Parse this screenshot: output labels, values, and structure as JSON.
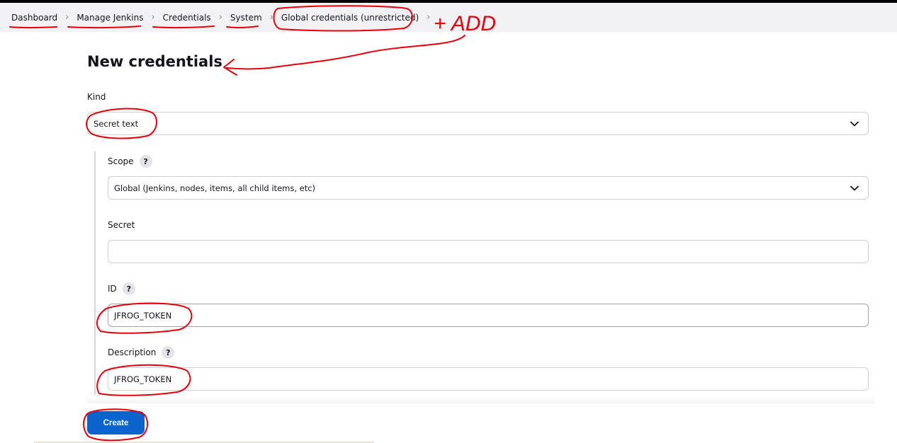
{
  "breadcrumb": {
    "items": [
      {
        "label": "Dashboard"
      },
      {
        "label": "Manage Jenkins"
      },
      {
        "label": "Credentials"
      },
      {
        "label": "System"
      },
      {
        "label": "Global credentials (unrestricted)"
      }
    ]
  },
  "page": {
    "title": "New credentials"
  },
  "form": {
    "kind": {
      "label": "Kind",
      "value": "Secret text"
    },
    "scope": {
      "label": "Scope",
      "help": "?",
      "value": "Global (Jenkins, nodes, items, all child items, etc)"
    },
    "secret": {
      "label": "Secret",
      "value": ""
    },
    "id": {
      "label": "ID",
      "help": "?",
      "value": "JFROG_TOKEN"
    },
    "description": {
      "label": "Description",
      "help": "?",
      "value": "JFROG_TOKEN"
    }
  },
  "actions": {
    "create_label": "Create"
  },
  "annotation": {
    "text": "+ ADD",
    "color": "#e8000b"
  },
  "colors": {
    "accent": "#0b63ce",
    "annotation": "#e8000b"
  }
}
